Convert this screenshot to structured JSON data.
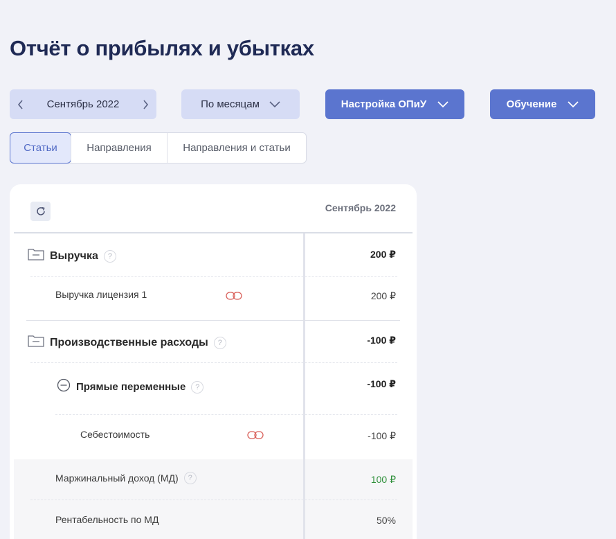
{
  "page": {
    "title": "Отчёт о прибылях и убытках"
  },
  "controls": {
    "period": "Сентябрь 2022",
    "grouping": "По месяцам",
    "settings": "Настройка ОПиУ",
    "training": "Обучение"
  },
  "tabs": [
    "Статьи",
    "Направления",
    "Направления и статьи"
  ],
  "table": {
    "column": "Сентябрь 2022",
    "rows": [
      {
        "name": "Выручка",
        "value": "200 ₽"
      },
      {
        "name": "Выручка лицензия 1",
        "value": "200 ₽"
      },
      {
        "name": "Производственные расходы",
        "value": "-100 ₽"
      },
      {
        "name": "Прямые переменные",
        "value": "-100 ₽"
      },
      {
        "name": "Себестоимость",
        "value": "-100 ₽"
      },
      {
        "name": "Маржинальный доход (МД)",
        "value": "100 ₽"
      },
      {
        "name": "Рентабельность по МД",
        "value": "50%"
      }
    ]
  },
  "colors": {
    "accent": "#5b75cf",
    "positive": "#2e8f3a",
    "link": "#d9605a"
  }
}
